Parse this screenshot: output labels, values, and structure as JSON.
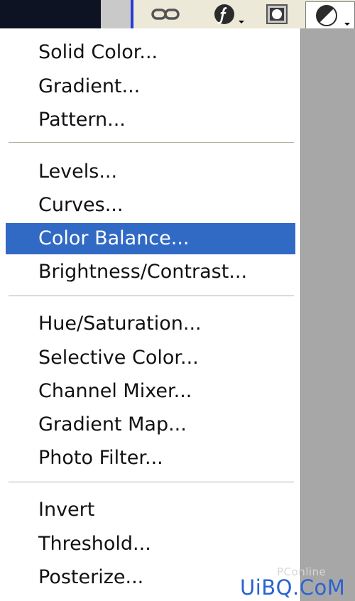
{
  "toolbar": {
    "buttons": [
      {
        "icon": "link-layers-icon"
      },
      {
        "icon": "add-layer-style-icon"
      },
      {
        "icon": "add-layer-mask-icon"
      },
      {
        "icon": "new-fill-adjustment-layer-icon"
      }
    ]
  },
  "menu": {
    "groups": [
      {
        "items": [
          {
            "label": "Solid Color..."
          },
          {
            "label": "Gradient..."
          },
          {
            "label": "Pattern..."
          }
        ]
      },
      {
        "items": [
          {
            "label": "Levels..."
          },
          {
            "label": "Curves..."
          },
          {
            "label": "Color Balance...",
            "highlighted": true
          },
          {
            "label": "Brightness/Contrast..."
          }
        ]
      },
      {
        "items": [
          {
            "label": "Hue/Saturation..."
          },
          {
            "label": "Selective Color..."
          },
          {
            "label": "Channel Mixer..."
          },
          {
            "label": "Gradient Map..."
          },
          {
            "label": "Photo Filter..."
          }
        ]
      },
      {
        "items": [
          {
            "label": "Invert"
          },
          {
            "label": "Threshold..."
          },
          {
            "label": "Posterize..."
          }
        ]
      }
    ]
  },
  "watermark": {
    "small": "PConline",
    "main": "UiBQ.CoM"
  },
  "colors": {
    "highlight": "#316ac5",
    "toolbar_bg": "#ece9d8",
    "accent_border": "#2a3bd6",
    "watermark": "#2a63d0"
  }
}
